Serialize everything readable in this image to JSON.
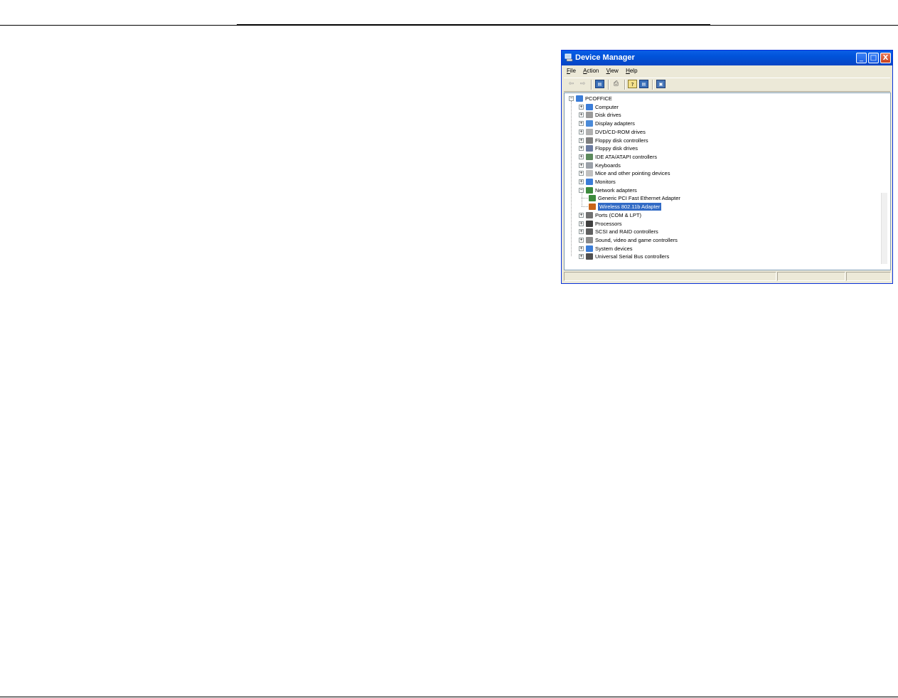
{
  "window": {
    "title": "Device Manager",
    "accent": "#0052d9",
    "buttons": {
      "minimize": "_",
      "maximize": "□",
      "close": "X"
    }
  },
  "menu": [
    "File",
    "Action",
    "View",
    "Help"
  ],
  "toolbar": [
    "back-icon",
    "forward-icon",
    "properties-icon",
    "print-icon",
    "help-icon",
    "update-driver-icon",
    "scan-hardware-icon"
  ],
  "tree": {
    "root": "PCOFFICE",
    "categories": [
      {
        "label": "Computer",
        "expanded": false,
        "icon": "computer-icon",
        "color": "#3b7dd8"
      },
      {
        "label": "Disk drives",
        "expanded": false,
        "icon": "disk-drive-icon",
        "color": "#9a9a9a"
      },
      {
        "label": "Display adapters",
        "expanded": false,
        "icon": "display-adapter-icon",
        "color": "#4a8ad8"
      },
      {
        "label": "DVD/CD-ROM drives",
        "expanded": false,
        "icon": "cdrom-icon",
        "color": "#b0b0b0"
      },
      {
        "label": "Floppy disk controllers",
        "expanded": false,
        "icon": "floppy-controller-icon",
        "color": "#808080"
      },
      {
        "label": "Floppy disk drives",
        "expanded": false,
        "icon": "floppy-drive-icon",
        "color": "#6a7aa0"
      },
      {
        "label": "IDE ATA/ATAPI controllers",
        "expanded": false,
        "icon": "ide-controller-icon",
        "color": "#5c8a5c"
      },
      {
        "label": "Keyboards",
        "expanded": false,
        "icon": "keyboard-icon",
        "color": "#9aa0a8"
      },
      {
        "label": "Mice and other pointing devices",
        "expanded": false,
        "icon": "mouse-icon",
        "color": "#c0c0c0"
      },
      {
        "label": "Monitors",
        "expanded": false,
        "icon": "monitor-icon",
        "color": "#3b7dd8"
      },
      {
        "label": "Network adapters",
        "expanded": true,
        "icon": "network-adapter-icon",
        "color": "#3c8a3c",
        "children": [
          {
            "label": "Generic PCI Fast Ethernet Adapter",
            "icon": "ethernet-adapter-icon",
            "color": "#3c8a3c",
            "selected": false
          },
          {
            "label": "Wireless 802.11b Adapter",
            "icon": "wireless-adapter-icon",
            "color": "#c86418",
            "selected": true
          }
        ]
      },
      {
        "label": "Ports (COM & LPT)",
        "expanded": false,
        "icon": "ports-icon",
        "color": "#707070"
      },
      {
        "label": "Processors",
        "expanded": false,
        "icon": "processor-icon",
        "color": "#404040"
      },
      {
        "label": "SCSI and RAID controllers",
        "expanded": false,
        "icon": "scsi-icon",
        "color": "#606060"
      },
      {
        "label": "Sound, video and game controllers",
        "expanded": false,
        "icon": "sound-icon",
        "color": "#8a8a8a"
      },
      {
        "label": "System devices",
        "expanded": false,
        "icon": "system-devices-icon",
        "color": "#3b7dd8"
      },
      {
        "label": "Universal Serial Bus controllers",
        "expanded": false,
        "icon": "usb-icon",
        "color": "#505050"
      }
    ]
  }
}
